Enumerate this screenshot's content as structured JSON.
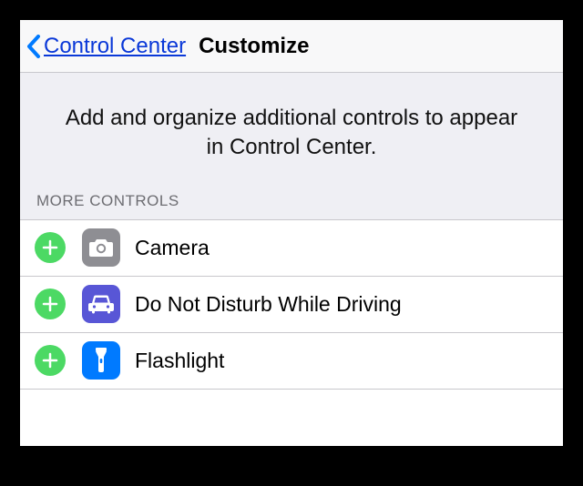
{
  "nav": {
    "back_label": "Control Center",
    "title": "Customize"
  },
  "info": {
    "text": "Add and organize additional controls to appear in Control Center."
  },
  "section": {
    "header": "MORE CONTROLS",
    "items": [
      {
        "label": "Camera",
        "icon": "camera-icon"
      },
      {
        "label": "Do Not Disturb While Driving",
        "icon": "car-icon"
      },
      {
        "label": "Flashlight",
        "icon": "flashlight-icon"
      }
    ]
  },
  "colors": {
    "link": "#0a38d8",
    "chevron": "#007aff",
    "add": "#4cd964",
    "camera_bg": "#8e8e93",
    "car_bg": "#5856d6",
    "torch_bg": "#007aff"
  }
}
